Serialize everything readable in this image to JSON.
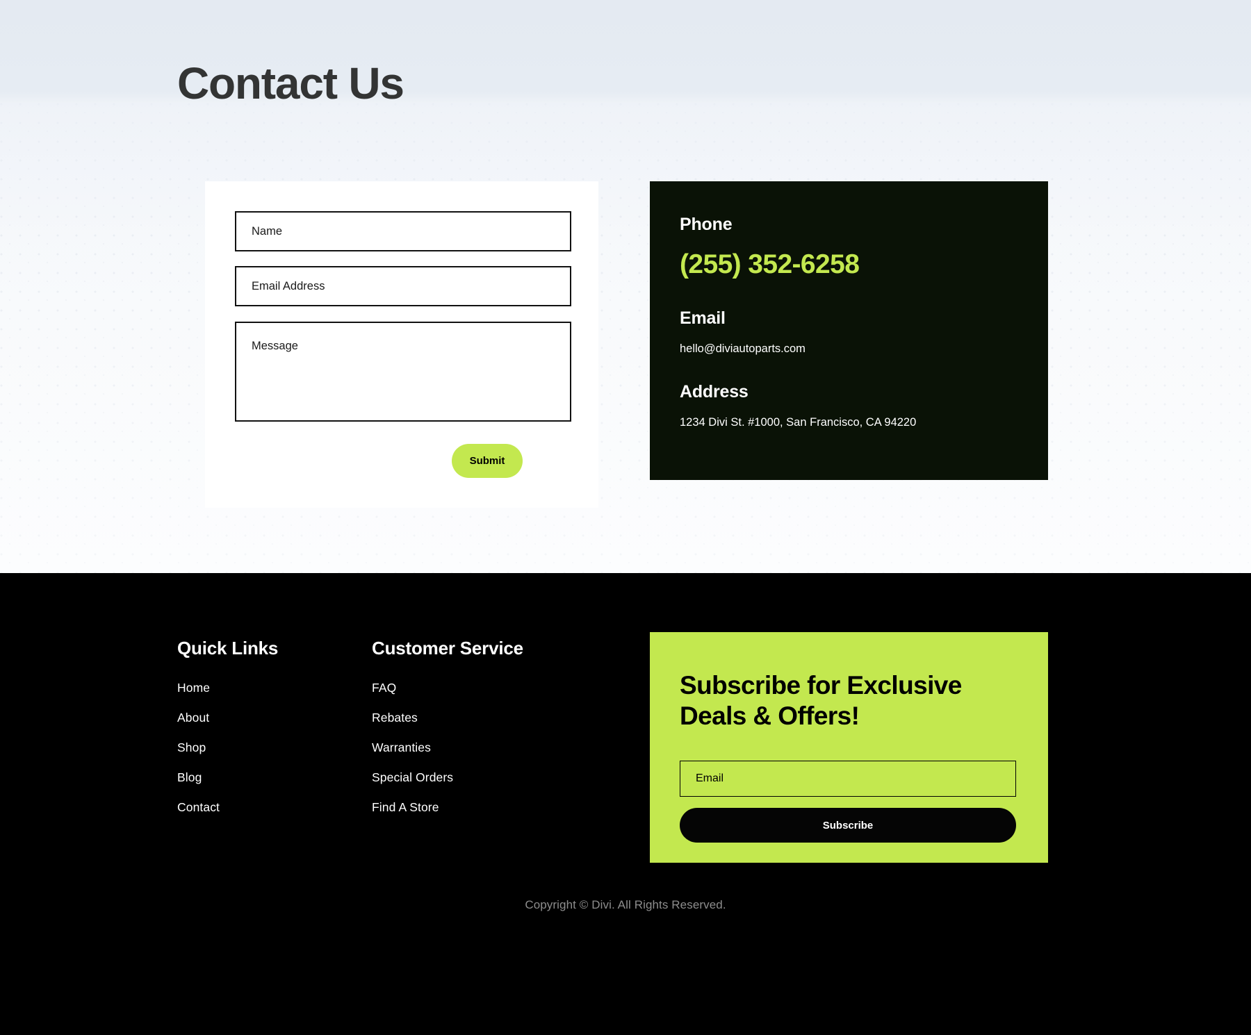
{
  "page": {
    "title": "Contact Us"
  },
  "contact_form": {
    "name_placeholder": "Name",
    "email_placeholder": "Email Address",
    "message_placeholder": "Message",
    "submit_label": "Submit",
    "name_value": "",
    "email_value": "",
    "message_value": ""
  },
  "contact_info": {
    "phone_label": "Phone",
    "phone_value": "(255) 352-6258",
    "email_label": "Email",
    "email_value": "hello@diviautoparts.com",
    "address_label": "Address",
    "address_value": "1234 Divi St. #1000, San Francisco, CA 94220"
  },
  "footer": {
    "quick_links": {
      "heading": "Quick Links",
      "items": [
        {
          "label": "Home"
        },
        {
          "label": "About"
        },
        {
          "label": "Shop"
        },
        {
          "label": "Blog"
        },
        {
          "label": "Contact"
        }
      ]
    },
    "customer_service": {
      "heading": "Customer Service",
      "items": [
        {
          "label": "FAQ"
        },
        {
          "label": "Rebates"
        },
        {
          "label": "Warranties"
        },
        {
          "label": "Special Orders"
        },
        {
          "label": "Find A Store"
        }
      ]
    },
    "subscribe": {
      "heading_line1": "Subscribe for Exclusive",
      "heading_line2": "Deals & Offers!",
      "email_placeholder": "Email",
      "email_value": "",
      "button_label": "Subscribe"
    },
    "copyright": "Copyright © Divi. All Rights Reserved."
  },
  "colors": {
    "accent_lime": "#c3e84f",
    "dark_panel": "#0a1206",
    "footer_black": "#000000",
    "title_dark": "#333434",
    "hero_bg": "#e8edf4"
  }
}
